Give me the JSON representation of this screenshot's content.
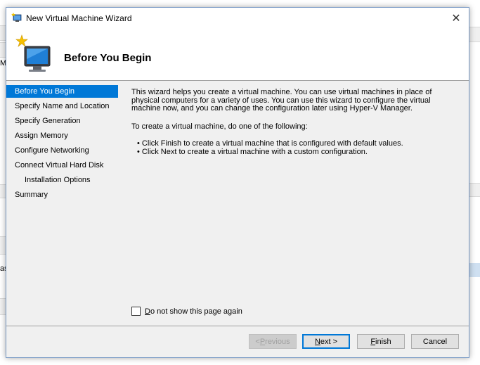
{
  "window": {
    "title": "New Virtual Machine Wizard",
    "close_glyph": "✕"
  },
  "header": {
    "title": "Before You Begin"
  },
  "nav": {
    "items": [
      {
        "label": "Before You Begin",
        "selected": true,
        "indent": false
      },
      {
        "label": "Specify Name and Location",
        "selected": false,
        "indent": false
      },
      {
        "label": "Specify Generation",
        "selected": false,
        "indent": false
      },
      {
        "label": "Assign Memory",
        "selected": false,
        "indent": false
      },
      {
        "label": "Configure Networking",
        "selected": false,
        "indent": false
      },
      {
        "label": "Connect Virtual Hard Disk",
        "selected": false,
        "indent": false
      },
      {
        "label": "Installation Options",
        "selected": false,
        "indent": true
      },
      {
        "label": "Summary",
        "selected": false,
        "indent": false
      }
    ]
  },
  "content": {
    "intro": "This wizard helps you create a virtual machine. You can use virtual machines in place of physical computers for a variety of uses. You can use this wizard to configure the virtual machine now, and you can change the configuration later using Hyper-V Manager.",
    "instruction": "To create a virtual machine, do one of the following:",
    "bullet_1": "• Click Finish to create a virtual machine that is configured with default values.",
    "bullet_2": "• Click Next to create a virtual machine with a custom configuration."
  },
  "checkbox": {
    "label_underlined": "D",
    "label_rest": "o not show this page again",
    "checked": false
  },
  "buttons": {
    "previous_pre": "< ",
    "previous_ul": "P",
    "previous_rest": "revious",
    "next_ul": "N",
    "next_rest": "ext >",
    "finish_ul": "F",
    "finish_rest": "inish",
    "cancel": "Cancel"
  },
  "background": {
    "frag_left_1": "M",
    "frag_left_2": "as"
  },
  "colors": {
    "selection": "#0078d7",
    "dialog_bg": "#f0f0f0",
    "border": "#7a9bc6"
  }
}
